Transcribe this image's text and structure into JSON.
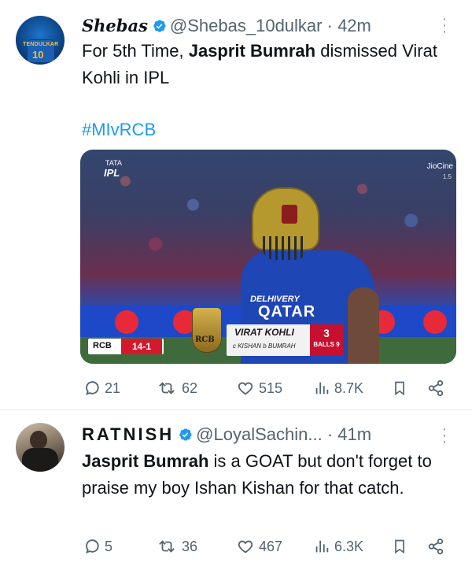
{
  "tweets": [
    {
      "display_name": "Shebas",
      "handle": "@Shebas_10dulkar",
      "time": "· 42m",
      "avatar": {
        "jersey_name": "TENDULKAR",
        "jersey_number": "10"
      },
      "body_parts": [
        "For 5th Time, ",
        "Jasprit Bumrah",
        " dismissed Virat Kohli in IPL"
      ],
      "hashtag": "#MIvRCB",
      "media": {
        "ipl_logo": "IPL",
        "ipl_mark": "TATA",
        "corner_label": "JioCine",
        "corner_sub": "1.5",
        "sponsor_small": "DELHIVERY",
        "sponsor": "QATAR",
        "score_team": "RCB",
        "score_value": "14-1",
        "rcb_logo_text": "RCB",
        "batter_name": "VIRAT KOHLI",
        "dismissal": "c KISHAN  b BUMRAH",
        "runs": "3",
        "balls": "BALLS 9"
      },
      "stats": {
        "replies": "21",
        "reposts": "62",
        "likes": "515",
        "views": "8.7K"
      }
    },
    {
      "display_name": "RATNISH",
      "handle": "@LoyalSachin...",
      "time": "· 41m",
      "body_parts": [
        "Jasprit Bumrah",
        " is a GOAT but don't forget to praise my boy Ishan Kishan for that catch."
      ],
      "stats": {
        "replies": "5",
        "reposts": "36",
        "likes": "467",
        "views": "6.3K"
      }
    }
  ],
  "colors": {
    "link": "#1d9bf0",
    "verified": "#1d9bf0",
    "muted": "#536471",
    "text": "#0f1419"
  },
  "icons": [
    "verified-badge-icon",
    "more-options-icon",
    "reply-icon",
    "repost-icon",
    "like-icon",
    "views-icon",
    "bookmark-icon",
    "share-icon"
  ]
}
